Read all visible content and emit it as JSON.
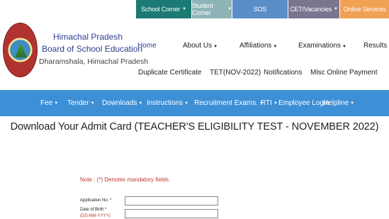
{
  "topbar": {
    "school_corner": "School Corner",
    "student_corner": "Student Corner",
    "sos": "SOS",
    "cet_vacancies": "CET/Vacancies",
    "online_services": "Online Services"
  },
  "brand": {
    "line1": "Himachal Pradesh",
    "line2": "Board of School Education",
    "line3": "Dharamshala, Himachal Pradesh"
  },
  "nav_primary": {
    "home": "Home",
    "about": "About Us",
    "affiliations": "Affiliations",
    "examinations": "Examinations",
    "results": "Results"
  },
  "nav_secondary": {
    "duplicate": "Duplicate Certificate",
    "tet": "TET(NOV-2022)",
    "notifications": "Notifications",
    "misc": "Misc Online Payment"
  },
  "menu": {
    "fee": "Fee",
    "tender": "Tender",
    "downloads": "Downloads",
    "instructions": "Instructions",
    "recruitment": "Recruitment Exams.",
    "rti": "RTI",
    "employee_login": "Employee Login",
    "helpline": "Helpline"
  },
  "page": {
    "title": "Download Your Admit Card (TEACHER'S ELIGIBILITY TEST - NOVEMBER 2022)",
    "note": "Note : (*) Denotes mandatory fields."
  },
  "form": {
    "application_label": "Application No. *",
    "dob_label": "Date of Birth *",
    "dob_format": "(DD-MM-YYYY)",
    "application_value": "",
    "dob_value": ""
  },
  "colors": {
    "menu_blue": "#3d8fd6",
    "brand_navy": "#2e3d8f",
    "note_red": "#c0392b"
  }
}
